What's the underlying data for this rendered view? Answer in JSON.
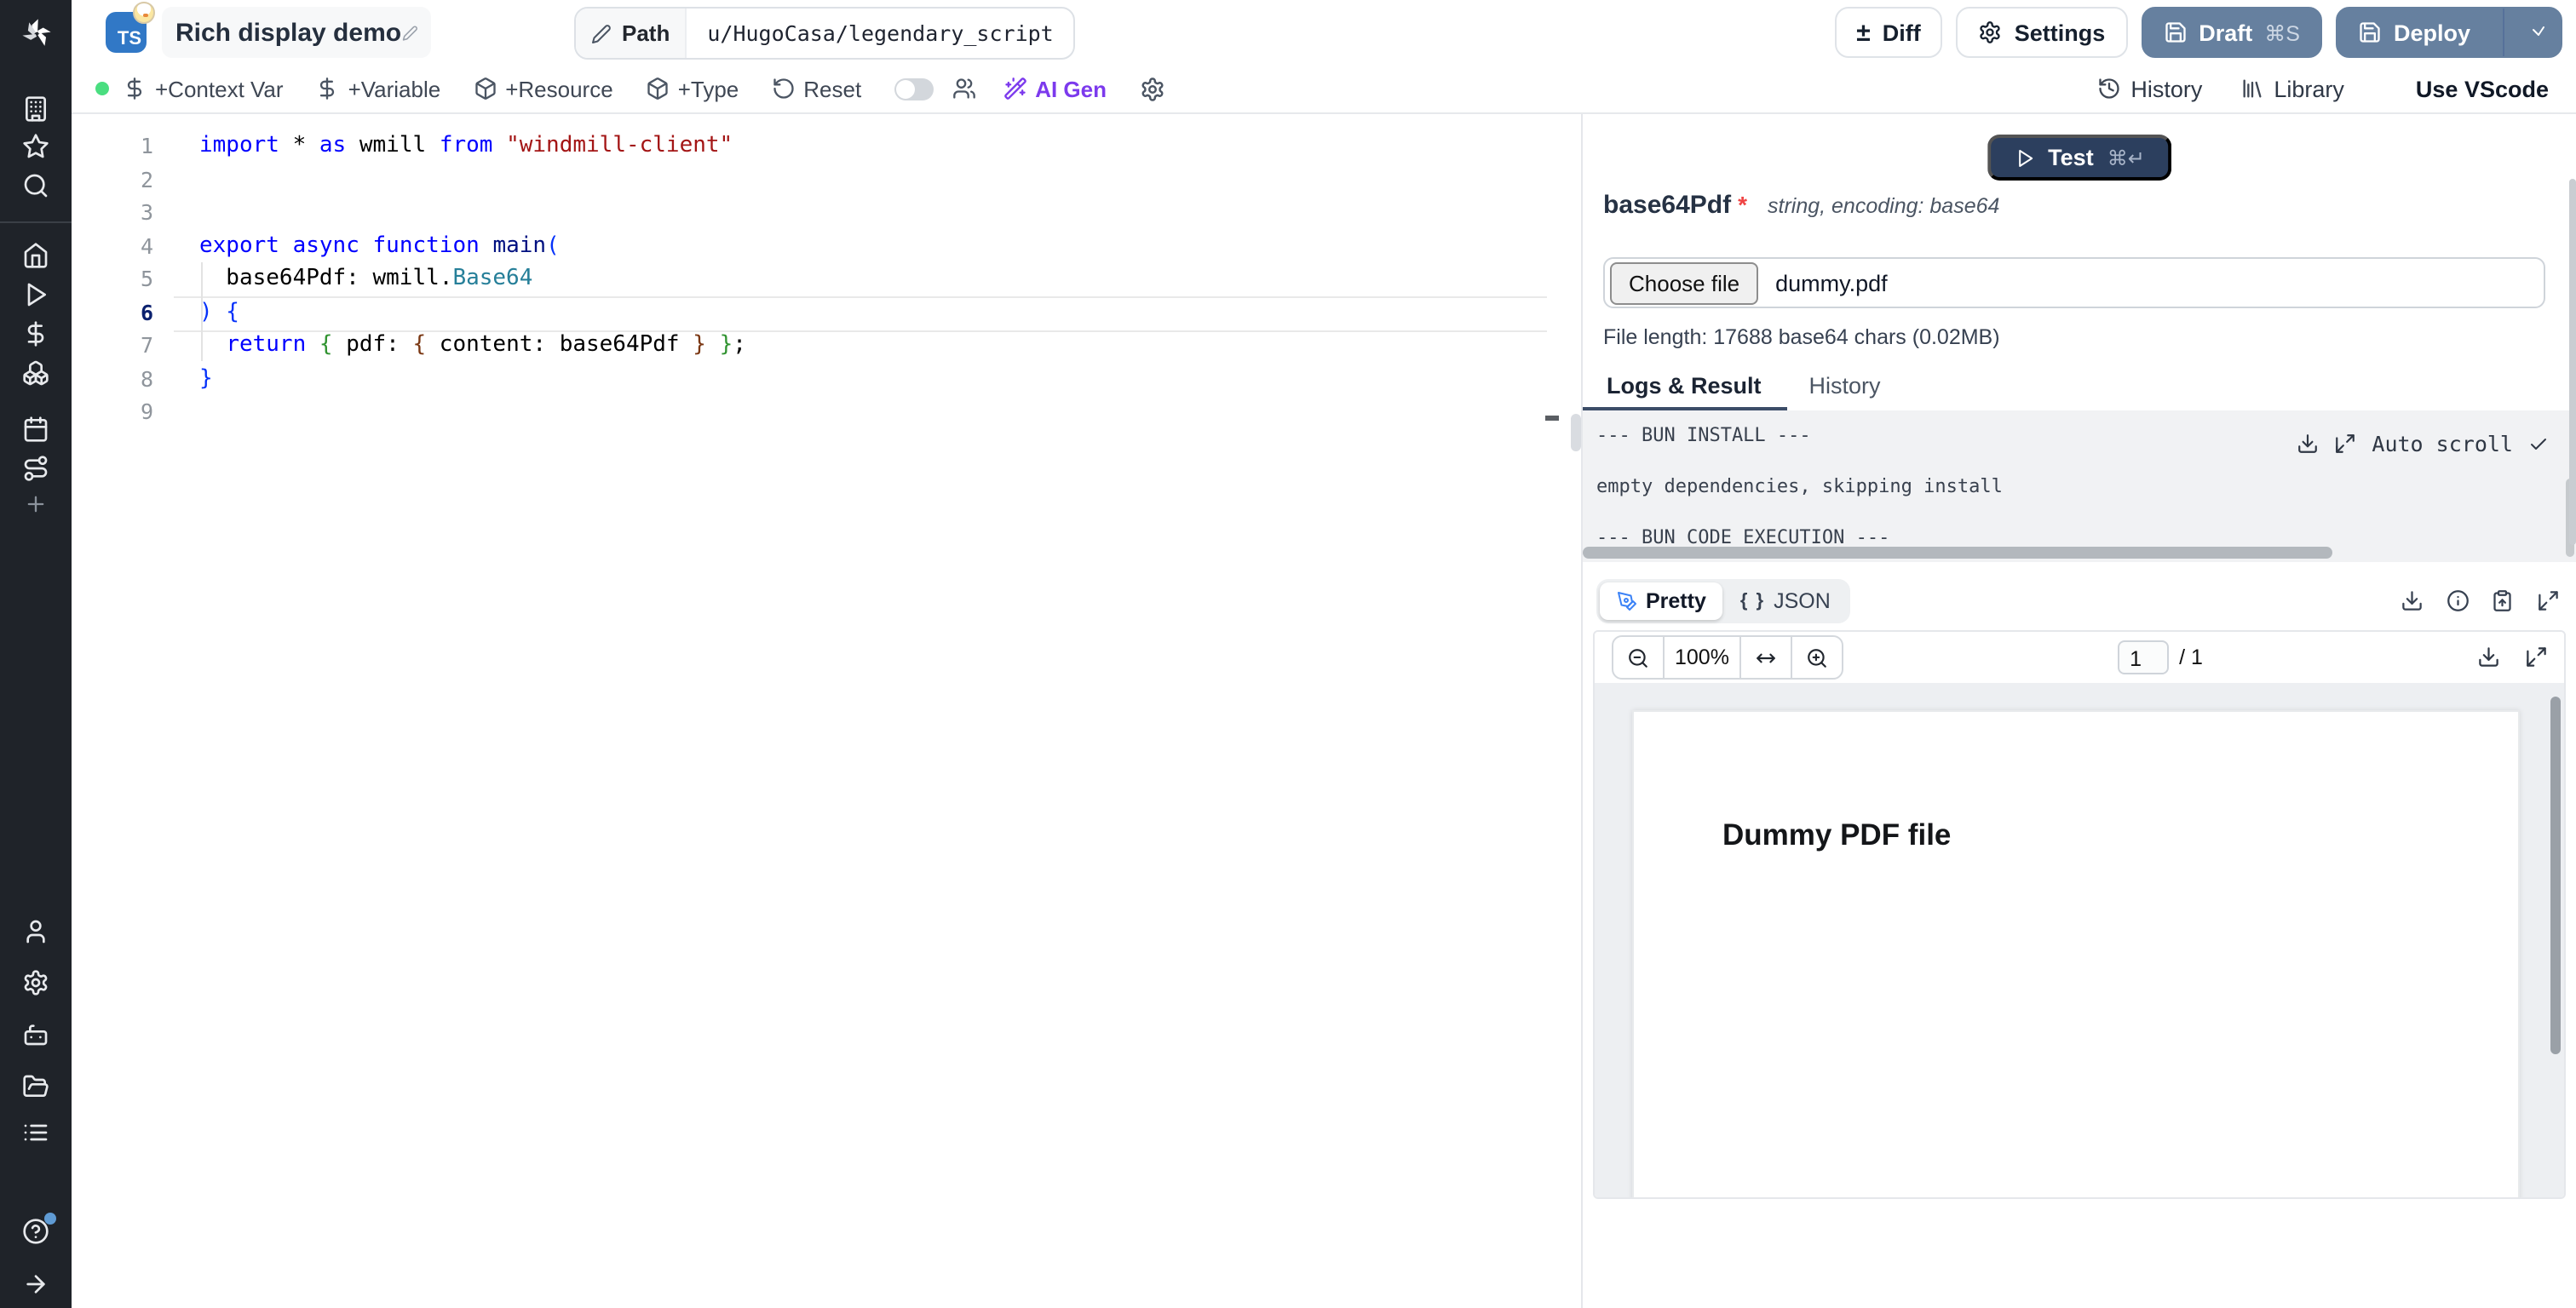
{
  "header": {
    "lang_badge": "TS",
    "title": "Rich display demo",
    "path_label": "Path",
    "path_value": "u/HugoCasa/legendary_script",
    "diff_label": "Diff",
    "settings_label": "Settings",
    "draft_label": "Draft",
    "draft_shortcut": "⌘S",
    "deploy_label": "Deploy",
    "diff_icon_glyph": "±"
  },
  "toolbar": {
    "context_var": "+Context Var",
    "variable": "+Variable",
    "resource": "+Resource",
    "type": "+Type",
    "reset": "Reset",
    "ai_gen": "AI Gen",
    "history": "History",
    "library": "Library",
    "use_vscode": "Use VScode"
  },
  "sidebar": {
    "icons": [
      "windmill-logo",
      "workspace-building",
      "star",
      "search",
      "home",
      "runs-play",
      "variables-dollar",
      "resources-boxes",
      "schedules-calendar",
      "flows-route",
      "add-plus",
      "user",
      "settings-gear",
      "workers-robot",
      "folders",
      "audit-logs-list",
      "help",
      "collapse-arrow"
    ]
  },
  "editor": {
    "active_line": 6,
    "lines": [
      {
        "n": "1",
        "tokens": [
          {
            "c": "k",
            "t": "import"
          },
          {
            "c": "p",
            "t": " * "
          },
          {
            "c": "k",
            "t": "as"
          },
          {
            "c": "p",
            "t": " wmill "
          },
          {
            "c": "k",
            "t": "from"
          },
          {
            "c": "p",
            "t": " "
          },
          {
            "c": "s",
            "t": "\"windmill-client\""
          }
        ]
      },
      {
        "n": "2",
        "tokens": []
      },
      {
        "n": "3",
        "tokens": []
      },
      {
        "n": "4",
        "tokens": [
          {
            "c": "k",
            "t": "export"
          },
          {
            "c": "p",
            "t": " "
          },
          {
            "c": "k",
            "t": "async"
          },
          {
            "c": "p",
            "t": " "
          },
          {
            "c": "k",
            "t": "function"
          },
          {
            "c": "p",
            "t": " "
          },
          {
            "c": "f",
            "t": "main"
          },
          {
            "c": "b1",
            "t": "("
          }
        ]
      },
      {
        "n": "5",
        "tokens": [
          {
            "c": "p",
            "t": "  base64Pdf: wmill."
          },
          {
            "c": "t",
            "t": "Base64"
          }
        ]
      },
      {
        "n": "6",
        "tokens": [
          {
            "c": "b1",
            "t": ") {"
          }
        ]
      },
      {
        "n": "7",
        "tokens": [
          {
            "c": "p",
            "t": "  "
          },
          {
            "c": "k",
            "t": "return"
          },
          {
            "c": "p",
            "t": " "
          },
          {
            "c": "b2",
            "t": "{"
          },
          {
            "c": "p",
            "t": " pdf: "
          },
          {
            "c": "b3",
            "t": "{"
          },
          {
            "c": "p",
            "t": " content: base64Pdf "
          },
          {
            "c": "b3",
            "t": "}"
          },
          {
            "c": "p",
            "t": " "
          },
          {
            "c": "b2",
            "t": "}"
          },
          {
            "c": "p",
            "t": ";"
          }
        ]
      },
      {
        "n": "8",
        "tokens": [
          {
            "c": "b1",
            "t": "}"
          }
        ]
      },
      {
        "n": "9",
        "tokens": []
      }
    ]
  },
  "panel": {
    "test_label": "Test",
    "test_shortcut": "⌘↵",
    "arg_name": "base64Pdf",
    "arg_required": "*",
    "arg_type": "string, encoding: base64",
    "choose_file_label": "Choose file",
    "file_name": "dummy.pdf",
    "file_length": "File length: 17688 base64 chars (0.02MB)",
    "tabs": {
      "logs_result": "Logs & Result",
      "history": "History"
    },
    "logs": {
      "lines": [
        "--- BUN INSTALL ---",
        "empty dependencies, skipping install",
        "--- BUN CODE EXECUTION ---"
      ],
      "auto_scroll_label": "Auto scroll"
    },
    "result": {
      "pretty_label": "Pretty",
      "json_label": "JSON",
      "braces_glyph": "{ }"
    },
    "pdf": {
      "zoom_level": "100%",
      "page_current": "1",
      "page_total": "/ 1",
      "content_text": "Dummy PDF file"
    }
  },
  "colors": {
    "accent_button": "#66809f",
    "test_button": "#2c3f5e",
    "ai_gen_purple": "#7c3aed",
    "ts_badge_blue": "#3178c6",
    "status_green": "#4ade80",
    "required_red": "#ef4444",
    "tab_underline": "#3c4d68"
  }
}
